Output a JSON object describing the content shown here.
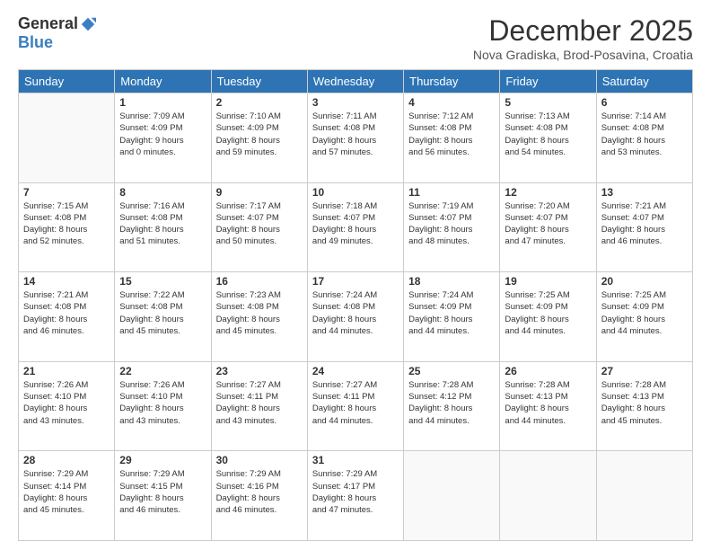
{
  "header": {
    "logo_general": "General",
    "logo_blue": "Blue",
    "month_title": "December 2025",
    "location": "Nova Gradiska, Brod-Posavina, Croatia"
  },
  "weekdays": [
    "Sunday",
    "Monday",
    "Tuesday",
    "Wednesday",
    "Thursday",
    "Friday",
    "Saturday"
  ],
  "weeks": [
    [
      {
        "day": "",
        "info": ""
      },
      {
        "day": "1",
        "info": "Sunrise: 7:09 AM\nSunset: 4:09 PM\nDaylight: 9 hours\nand 0 minutes."
      },
      {
        "day": "2",
        "info": "Sunrise: 7:10 AM\nSunset: 4:09 PM\nDaylight: 8 hours\nand 59 minutes."
      },
      {
        "day": "3",
        "info": "Sunrise: 7:11 AM\nSunset: 4:08 PM\nDaylight: 8 hours\nand 57 minutes."
      },
      {
        "day": "4",
        "info": "Sunrise: 7:12 AM\nSunset: 4:08 PM\nDaylight: 8 hours\nand 56 minutes."
      },
      {
        "day": "5",
        "info": "Sunrise: 7:13 AM\nSunset: 4:08 PM\nDaylight: 8 hours\nand 54 minutes."
      },
      {
        "day": "6",
        "info": "Sunrise: 7:14 AM\nSunset: 4:08 PM\nDaylight: 8 hours\nand 53 minutes."
      }
    ],
    [
      {
        "day": "7",
        "info": "Sunrise: 7:15 AM\nSunset: 4:08 PM\nDaylight: 8 hours\nand 52 minutes."
      },
      {
        "day": "8",
        "info": "Sunrise: 7:16 AM\nSunset: 4:08 PM\nDaylight: 8 hours\nand 51 minutes."
      },
      {
        "day": "9",
        "info": "Sunrise: 7:17 AM\nSunset: 4:07 PM\nDaylight: 8 hours\nand 50 minutes."
      },
      {
        "day": "10",
        "info": "Sunrise: 7:18 AM\nSunset: 4:07 PM\nDaylight: 8 hours\nand 49 minutes."
      },
      {
        "day": "11",
        "info": "Sunrise: 7:19 AM\nSunset: 4:07 PM\nDaylight: 8 hours\nand 48 minutes."
      },
      {
        "day": "12",
        "info": "Sunrise: 7:20 AM\nSunset: 4:07 PM\nDaylight: 8 hours\nand 47 minutes."
      },
      {
        "day": "13",
        "info": "Sunrise: 7:21 AM\nSunset: 4:07 PM\nDaylight: 8 hours\nand 46 minutes."
      }
    ],
    [
      {
        "day": "14",
        "info": "Sunrise: 7:21 AM\nSunset: 4:08 PM\nDaylight: 8 hours\nand 46 minutes."
      },
      {
        "day": "15",
        "info": "Sunrise: 7:22 AM\nSunset: 4:08 PM\nDaylight: 8 hours\nand 45 minutes."
      },
      {
        "day": "16",
        "info": "Sunrise: 7:23 AM\nSunset: 4:08 PM\nDaylight: 8 hours\nand 45 minutes."
      },
      {
        "day": "17",
        "info": "Sunrise: 7:24 AM\nSunset: 4:08 PM\nDaylight: 8 hours\nand 44 minutes."
      },
      {
        "day": "18",
        "info": "Sunrise: 7:24 AM\nSunset: 4:09 PM\nDaylight: 8 hours\nand 44 minutes."
      },
      {
        "day": "19",
        "info": "Sunrise: 7:25 AM\nSunset: 4:09 PM\nDaylight: 8 hours\nand 44 minutes."
      },
      {
        "day": "20",
        "info": "Sunrise: 7:25 AM\nSunset: 4:09 PM\nDaylight: 8 hours\nand 44 minutes."
      }
    ],
    [
      {
        "day": "21",
        "info": "Sunrise: 7:26 AM\nSunset: 4:10 PM\nDaylight: 8 hours\nand 43 minutes."
      },
      {
        "day": "22",
        "info": "Sunrise: 7:26 AM\nSunset: 4:10 PM\nDaylight: 8 hours\nand 43 minutes."
      },
      {
        "day": "23",
        "info": "Sunrise: 7:27 AM\nSunset: 4:11 PM\nDaylight: 8 hours\nand 43 minutes."
      },
      {
        "day": "24",
        "info": "Sunrise: 7:27 AM\nSunset: 4:11 PM\nDaylight: 8 hours\nand 44 minutes."
      },
      {
        "day": "25",
        "info": "Sunrise: 7:28 AM\nSunset: 4:12 PM\nDaylight: 8 hours\nand 44 minutes."
      },
      {
        "day": "26",
        "info": "Sunrise: 7:28 AM\nSunset: 4:13 PM\nDaylight: 8 hours\nand 44 minutes."
      },
      {
        "day": "27",
        "info": "Sunrise: 7:28 AM\nSunset: 4:13 PM\nDaylight: 8 hours\nand 45 minutes."
      }
    ],
    [
      {
        "day": "28",
        "info": "Sunrise: 7:29 AM\nSunset: 4:14 PM\nDaylight: 8 hours\nand 45 minutes."
      },
      {
        "day": "29",
        "info": "Sunrise: 7:29 AM\nSunset: 4:15 PM\nDaylight: 8 hours\nand 46 minutes."
      },
      {
        "day": "30",
        "info": "Sunrise: 7:29 AM\nSunset: 4:16 PM\nDaylight: 8 hours\nand 46 minutes."
      },
      {
        "day": "31",
        "info": "Sunrise: 7:29 AM\nSunset: 4:17 PM\nDaylight: 8 hours\nand 47 minutes."
      },
      {
        "day": "",
        "info": ""
      },
      {
        "day": "",
        "info": ""
      },
      {
        "day": "",
        "info": ""
      }
    ]
  ]
}
